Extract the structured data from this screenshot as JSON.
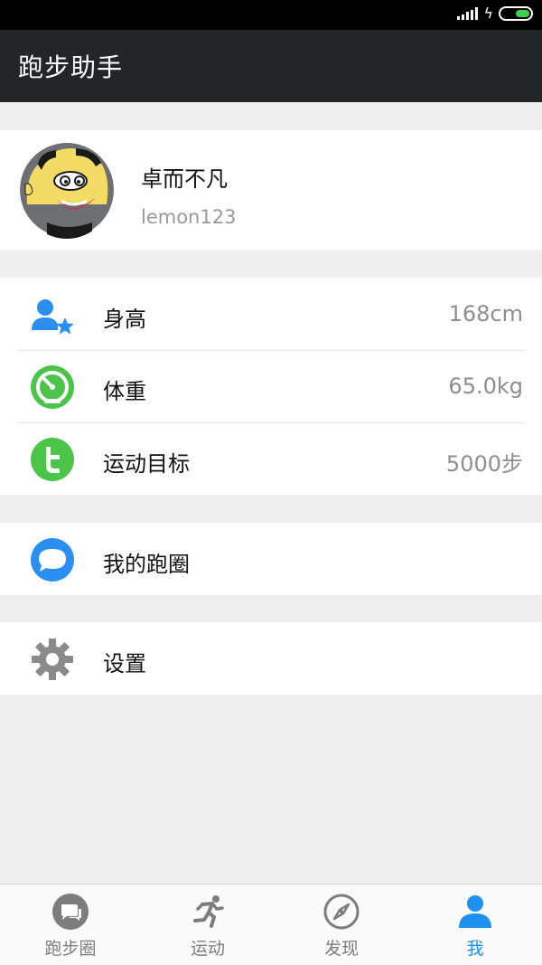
{
  "status_bar": {
    "signal_icon": "signal-bars-icon",
    "charging_icon": "bolt-icon",
    "battery_icon": "battery-icon",
    "battery_level": 0.5,
    "battery_color": "#3fd04d"
  },
  "app_bar": {
    "title": "跑步助手",
    "background": "#222629"
  },
  "profile": {
    "avatar_icon": "cartoon-avatar",
    "name": "卓而不凡",
    "username": "lemon123"
  },
  "stats": {
    "height": {
      "icon": "user-star-icon",
      "label": "身高",
      "value": "168cm"
    },
    "weight": {
      "icon": "speedometer-icon",
      "label": "体重",
      "value": "65.0kg"
    },
    "goal": {
      "icon": "twitter-t-icon",
      "label": "运动目标",
      "value": "5000步"
    }
  },
  "menu": {
    "my_circle": {
      "icon": "chat-bubble-icon",
      "label": "我的跑圈"
    },
    "settings": {
      "icon": "gear-icon",
      "label": "设置"
    }
  },
  "tabs": {
    "circle": {
      "icon": "chat-icon",
      "label": "跑步圈"
    },
    "sport": {
      "icon": "runner-icon",
      "label": "运动"
    },
    "discover": {
      "icon": "compass-icon",
      "label": "发现"
    },
    "me": {
      "icon": "person-icon",
      "label": "我",
      "active": true
    }
  },
  "colors": {
    "accent": "#1e90ef",
    "green": "#4cc44a",
    "gray_icon": "#7d7d7d"
  }
}
